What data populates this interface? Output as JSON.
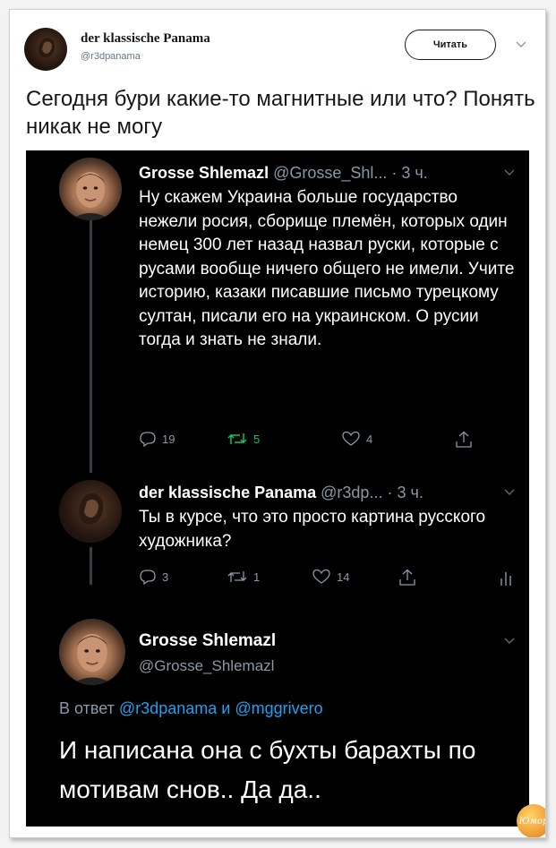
{
  "header": {
    "display_name": "der klassische Panama",
    "handle": "@r3dpanama",
    "follow_label": "Читать"
  },
  "tweet": {
    "text": "Сегодня бури какие-то магнитные или что? Понять никак не могу"
  },
  "screenshot": {
    "tweet1": {
      "name": "Grosse Shlemazl",
      "meta": "@Grosse_Shl... · 3 ч.",
      "text": "Ну скажем Украина больше государство нежели росия, сборище племён, которых один немец 300 лет назад назвал руски, которые с русами вообще ничего общего не имели. Учите историю, казаки писавшие письмо турецкому султан, писали его на украинском. О русии тогда и знать не знали.",
      "replies": "19",
      "retweets": "5",
      "likes": "4"
    },
    "tweet2": {
      "name": "der klassische Panama",
      "meta": "@r3dp... · 3 ч.",
      "text": "Ты в курсе, что это просто картина русского художника?",
      "replies": "3",
      "retweets": "1",
      "likes": "14"
    },
    "tweet3": {
      "name": "Grosse Shlemazl",
      "handle": "@Grosse_Shlemazl",
      "reply_prefix": "В ответ",
      "reply_user1": "@r3dpanama",
      "reply_and": "и",
      "reply_user2": "@mggrivero",
      "text": "И написана она с бухты барахты по мотивам снов.. Да да.."
    },
    "watermark": "Юмор"
  },
  "colors": {
    "dark_bg": "#000000",
    "muted_text": "#8899a6",
    "link": "#1da1f2",
    "retweet_green": "#17bf63"
  },
  "icons": [
    "reply-icon",
    "retweet-icon",
    "like-icon",
    "share-icon",
    "analytics-icon",
    "chevron-down-icon"
  ]
}
